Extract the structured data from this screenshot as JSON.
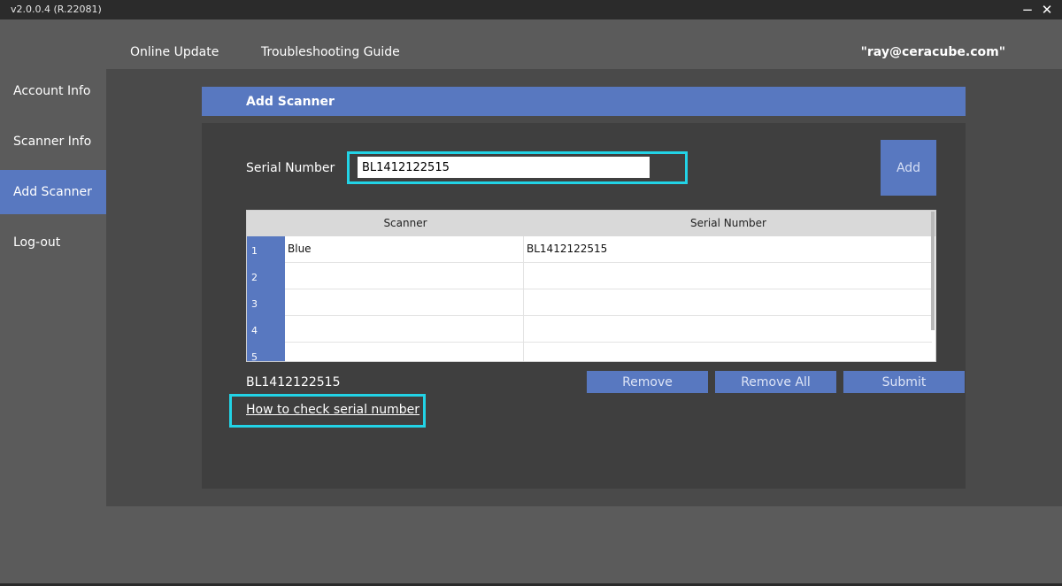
{
  "window": {
    "version": "v2.0.0.4  (R.22081)",
    "minimize_glyph": "−",
    "close_glyph": "✕"
  },
  "header": {
    "nav": [
      {
        "label": "Online Update"
      },
      {
        "label": "Troubleshooting Guide"
      }
    ],
    "user": "\"ray@ceracube.com\""
  },
  "sidebar": {
    "items": [
      {
        "label": "Account Info",
        "active": false
      },
      {
        "label": "Scanner Info",
        "active": false
      },
      {
        "label": "Add Scanner",
        "active": true
      },
      {
        "label": "Log-out",
        "active": false
      }
    ]
  },
  "panel": {
    "title": "Add Scanner",
    "serial_label": "Serial Number",
    "serial_value": "BL1412122515",
    "add_label": "Add",
    "table": {
      "columns": [
        "Scanner",
        "Serial Number"
      ],
      "rows": [
        {
          "num": "1",
          "scanner": "Blue",
          "serial": "BL1412122515"
        },
        {
          "num": "2",
          "scanner": "",
          "serial": ""
        },
        {
          "num": "3",
          "scanner": "",
          "serial": ""
        },
        {
          "num": "4",
          "scanner": "",
          "serial": ""
        },
        {
          "num": "5",
          "scanner": "",
          "serial": ""
        }
      ]
    },
    "current_serial": "BL1412122515",
    "buttons": {
      "remove": "Remove",
      "remove_all": "Remove All",
      "submit": "Submit"
    },
    "howto_link": "How to check serial number"
  },
  "colors": {
    "accent": "#5878c0",
    "highlight": "#22d3e6",
    "background": "#5b5b5b",
    "panel": "#3f3f3f"
  }
}
